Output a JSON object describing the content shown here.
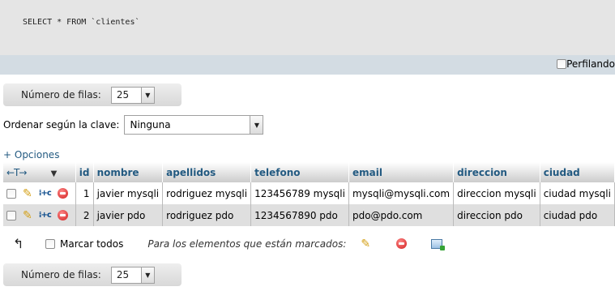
{
  "query": {
    "sql": "SELECT * FROM `clientes`"
  },
  "profiling": {
    "label": "Perfilando"
  },
  "nav": {
    "rows_label": "Número de filas:",
    "rows_value": "25"
  },
  "sort": {
    "label": "Ordenar según la clave:",
    "value": "Ninguna"
  },
  "options": {
    "label": "+ Opciones"
  },
  "table": {
    "header_arrows": "←T→",
    "columns": [
      "id",
      "nombre",
      "apellidos",
      "telefono",
      "email",
      "direccion",
      "ciudad"
    ],
    "rows": [
      {
        "id": "1",
        "nombre": "javier mysqli",
        "apellidos": "rodriguez mysqli",
        "telefono": "123456789 mysqli",
        "email": "mysqli@mysqli.com",
        "direccion": "direccion mysqli",
        "ciudad": "ciudad mysqli"
      },
      {
        "id": "2",
        "nombre": "javier pdo",
        "apellidos": "rodriguez pdo",
        "telefono": "1234567890 pdo",
        "email": "pdo@pdo.com",
        "direccion": "direccion pdo",
        "ciudad": "ciudad pdo"
      }
    ]
  },
  "bulk": {
    "check_all_label": "Marcar todos",
    "with_selected_label": "Para los elementos que están marcados:"
  },
  "icons": {
    "edit": "pencil-icon",
    "copy": "copy-icon",
    "delete": "delete-icon",
    "export": "export-icon",
    "corner": "corner-arrow-icon"
  },
  "colors": {
    "accent": "#235a81",
    "header_bar": "#d3dce3",
    "sql_bg": "#e5e5e5"
  }
}
